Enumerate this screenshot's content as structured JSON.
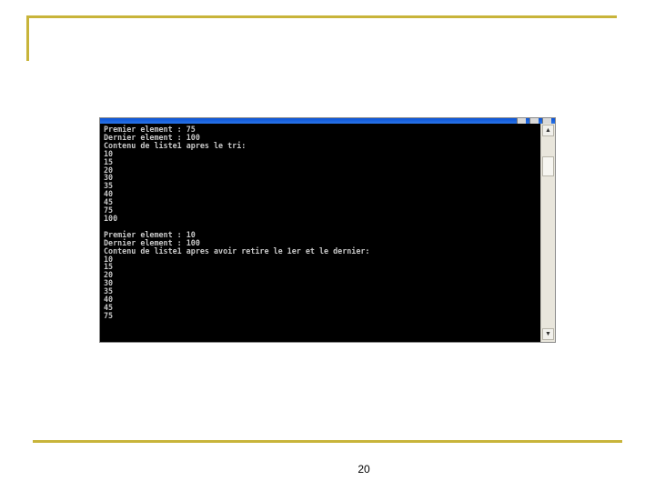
{
  "slide": {
    "page_number": "20"
  },
  "console": {
    "title": "",
    "lines": [
      "Premier element : 75",
      "Dernier element : 100",
      "Contenu de liste1 apres le tri:",
      "10",
      "15",
      "20",
      "30",
      "35",
      "40",
      "45",
      "75",
      "100",
      "",
      "Premier element : 10",
      "Dernier element : 100",
      "Contenu de liste1 apres avoir retire le 1er et le dernier:",
      "10",
      "15",
      "20",
      "30",
      "35",
      "40",
      "45",
      "75"
    ],
    "text_color": "#c8c8c8",
    "background_color": "#000000"
  },
  "scrollbar": {
    "up_icon": "arrow-up-icon",
    "down_icon": "arrow-down-icon"
  }
}
